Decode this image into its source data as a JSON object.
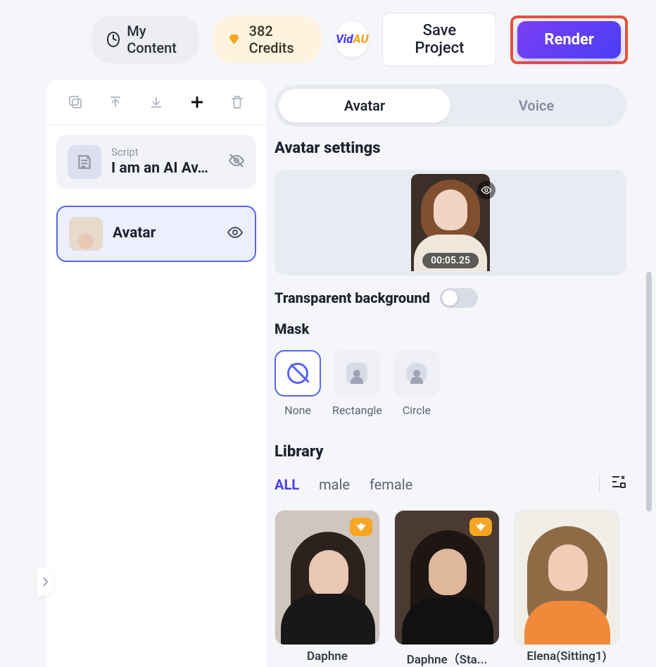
{
  "topbar": {
    "my_content": "My Content",
    "credits": "382 Credits",
    "logo_vid": "Vid",
    "logo_au": "AU",
    "save": "Save Project",
    "render": "Render"
  },
  "layers": {
    "script": {
      "label": "Script",
      "text": "I am an AI Av…"
    },
    "avatar": {
      "label": "Avatar"
    }
  },
  "tabs": {
    "avatar": "Avatar",
    "voice": "Voice"
  },
  "settings": {
    "title": "Avatar settings",
    "preview_time": "00:05.25",
    "transparent_bg": "Transparent background",
    "mask_title": "Mask",
    "masks": {
      "none": "None",
      "rectangle": "Rectangle",
      "circle": "Circle"
    }
  },
  "library": {
    "title": "Library",
    "filters": {
      "all": "ALL",
      "male": "male",
      "female": "female"
    },
    "cards": [
      {
        "name": "Daphne"
      },
      {
        "name": "Daphne（Sta..."
      },
      {
        "name": "Elena(Sitting1)"
      }
    ]
  }
}
